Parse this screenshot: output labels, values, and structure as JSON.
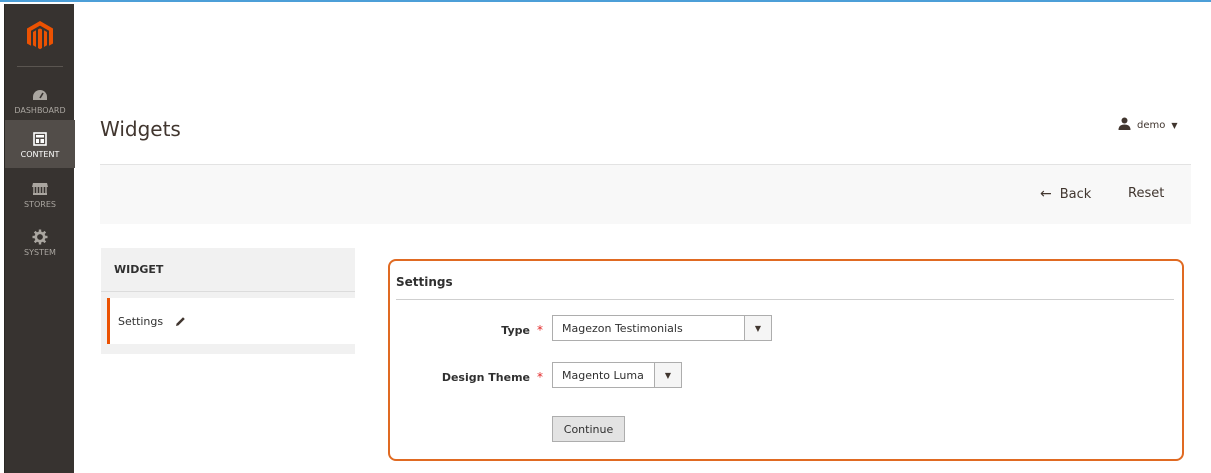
{
  "sidebar": {
    "items": [
      {
        "label": "DASHBOARD",
        "icon": "dashboard-icon"
      },
      {
        "label": "CONTENT",
        "icon": "content-icon"
      },
      {
        "label": "STORES",
        "icon": "stores-icon"
      },
      {
        "label": "SYSTEM",
        "icon": "system-icon"
      }
    ]
  },
  "header": {
    "title": "Widgets",
    "user": "demo"
  },
  "actions": {
    "back_label": "Back",
    "reset_label": "Reset"
  },
  "tabs": {
    "title": "WIDGET",
    "items": [
      {
        "label": "Settings"
      }
    ]
  },
  "settings": {
    "title": "Settings",
    "type_label": "Type",
    "type_value": "Magezon Testimonials",
    "theme_label": "Design Theme",
    "theme_value": "Magento Luma",
    "required_mark": "*",
    "continue_label": "Continue"
  },
  "colors": {
    "accent": "#eb5202",
    "highlight_border": "#e06a22",
    "sidebar_bg": "#373330",
    "required": "#e22626"
  }
}
